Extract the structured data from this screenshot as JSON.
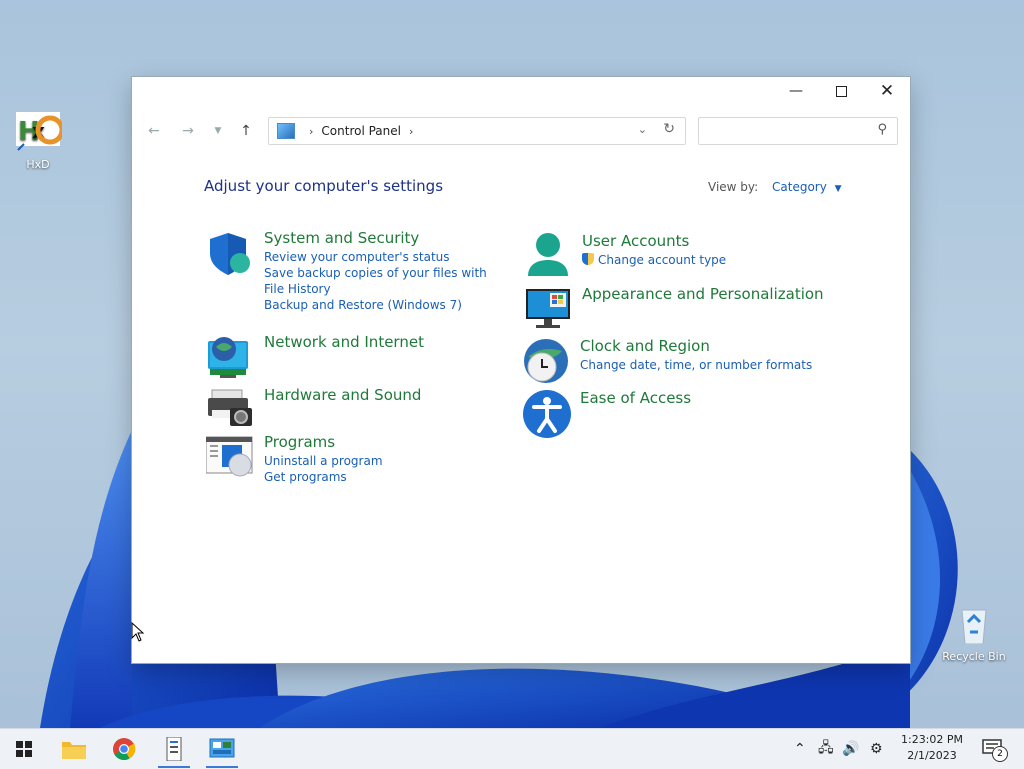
{
  "desktop": {
    "icons": [
      {
        "label": "HxD"
      },
      {
        "label": "Recycle Bin"
      }
    ]
  },
  "window": {
    "address": {
      "segment": "Control Panel"
    },
    "search": {
      "placeholder": ""
    },
    "heading": "Adjust your computer's settings",
    "view_by": {
      "label": "View by:",
      "value": "Category"
    },
    "categories_left": [
      {
        "title": "System and Security",
        "links": [
          "Review your computer's status",
          "Save backup copies of your files with File History",
          "Backup and Restore (Windows 7)"
        ]
      },
      {
        "title": "Network and Internet",
        "links": []
      },
      {
        "title": "Hardware and Sound",
        "links": []
      },
      {
        "title": "Programs",
        "links": [
          "Uninstall a program",
          "Get programs"
        ]
      }
    ],
    "categories_right": [
      {
        "title": "User Accounts",
        "links": [
          "Change account type"
        ]
      },
      {
        "title": "Appearance and Personalization",
        "links": []
      },
      {
        "title": "Clock and Region",
        "links": [
          "Change date, time, or number formats"
        ]
      },
      {
        "title": "Ease of Access",
        "links": []
      }
    ]
  },
  "taskbar": {
    "clock_time": "1:23:02 PM",
    "clock_date": "2/1/2023",
    "notification_count": "2"
  },
  "colors": {
    "accent": "#1a5fb4",
    "category_title": "#1f7a3a",
    "heading": "#1e3287"
  }
}
